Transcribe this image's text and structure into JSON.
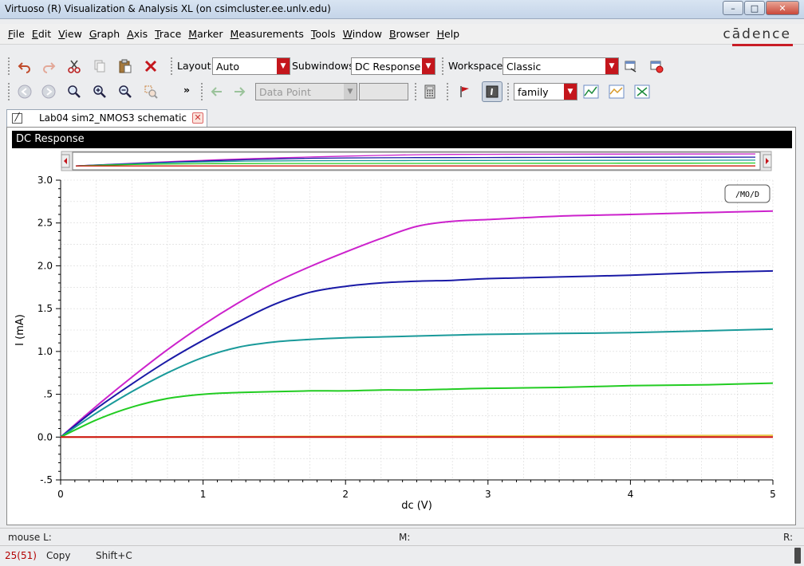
{
  "window": {
    "title": "Virtuoso (R) Visualization & Analysis XL (on csimcluster.ee.unlv.edu)",
    "minimize_symbol": "–",
    "maximize_symbol": "□",
    "close_symbol": "✕"
  },
  "menubar": {
    "items": [
      "File",
      "Edit",
      "View",
      "Graph",
      "Axis",
      "Trace",
      "Marker",
      "Measurements",
      "Tools",
      "Window",
      "Browser",
      "Help"
    ],
    "brand": "cādence",
    "brand_color": "#c81d25"
  },
  "toolbar1": {
    "icons": [
      "undo-icon",
      "redo-icon",
      "cut-icon",
      "copy-icon",
      "paste-icon",
      "delete-icon"
    ],
    "layout_label": "Layout:",
    "layout_value": "Auto",
    "subwindows_label": "Subwindows:",
    "subwindows_value": "DC Response",
    "workspace_label": "Workspace:",
    "workspace_value": "Classic",
    "arrow_symbol": "▼"
  },
  "toolbar2": {
    "icons": [
      "back-icon",
      "forward-icon",
      "zoom-fit-icon",
      "zoom-in-icon",
      "zoom-out-icon",
      "zoom-box-icon"
    ],
    "overflow": "»",
    "data_point_label": "Data Point",
    "family_value": "family",
    "arrow_symbol": "▼"
  },
  "tab": {
    "label": "Lab04 sim2_NMOS3 schematic",
    "close_symbol": "✕"
  },
  "plot": {
    "header": "DC Response",
    "legend_tag": "/MO/D",
    "colors": {
      "grid": "#d8d8d8",
      "axis": "#000000",
      "scroll_bg": "#e8e8e8"
    }
  },
  "chart_data": {
    "type": "line",
    "title": "",
    "xlabel": "dc (V)",
    "ylabel": "I (mA)",
    "xlim": [
      0,
      5
    ],
    "ylim": [
      -0.5,
      3.0
    ],
    "x_ticks": [
      "0",
      "1",
      "2",
      "3",
      "4",
      "5"
    ],
    "y_ticks": [
      "-.5",
      "0.0",
      ".5",
      "1.0",
      "1.5",
      "2.0",
      "2.5",
      "3.0"
    ],
    "x": [
      0,
      0.25,
      0.5,
      0.75,
      1.0,
      1.25,
      1.5,
      1.75,
      2.0,
      2.25,
      2.5,
      2.75,
      3.0,
      3.5,
      4.0,
      4.5,
      5.0
    ],
    "series": [
      {
        "color": "#cc22cc",
        "values": [
          0,
          0.36,
          0.7,
          1.02,
          1.31,
          1.57,
          1.8,
          1.99,
          2.16,
          2.32,
          2.46,
          2.52,
          2.54,
          2.58,
          2.6,
          2.62,
          2.64
        ]
      },
      {
        "color": "#1a1aa6",
        "values": [
          0,
          0.33,
          0.62,
          0.89,
          1.13,
          1.35,
          1.55,
          1.69,
          1.76,
          1.8,
          1.82,
          1.83,
          1.85,
          1.87,
          1.89,
          1.92,
          1.94
        ]
      },
      {
        "color": "#1a9a9a",
        "values": [
          0,
          0.28,
          0.53,
          0.75,
          0.93,
          1.05,
          1.11,
          1.14,
          1.16,
          1.17,
          1.18,
          1.19,
          1.2,
          1.21,
          1.22,
          1.24,
          1.26
        ]
      },
      {
        "color": "#22cc22",
        "values": [
          0,
          0.2,
          0.35,
          0.45,
          0.5,
          0.52,
          0.53,
          0.54,
          0.54,
          0.55,
          0.55,
          0.56,
          0.57,
          0.58,
          0.6,
          0.61,
          0.63
        ]
      },
      {
        "color": "#e8c84a",
        "values": [
          0,
          0.001,
          0.002,
          0.003,
          0.004,
          0.005,
          0.006,
          0.007,
          0.008,
          0.009,
          0.01,
          0.011,
          0.012,
          0.014,
          0.016,
          0.018,
          0.02
        ]
      },
      {
        "color": "#cc1111",
        "values": [
          0,
          0,
          0,
          0,
          0,
          0,
          0,
          0,
          0,
          0,
          0,
          0,
          0,
          0,
          0,
          0,
          0
        ]
      }
    ],
    "grid": true
  },
  "status": {
    "mouse_l": "mouse L:",
    "mouse_m": "M:",
    "mouse_r": "R:",
    "count": "25(51)",
    "command": "Copy",
    "shortcut": "Shift+C"
  }
}
